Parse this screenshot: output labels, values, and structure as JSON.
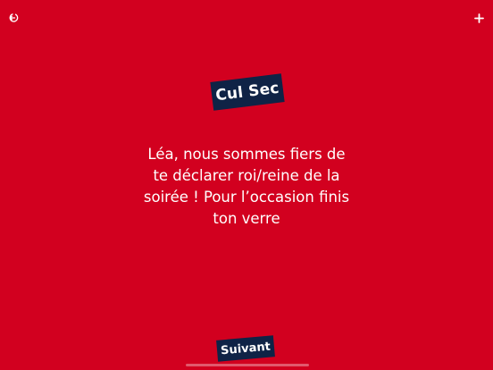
{
  "header": {
    "exit_icon": "exit-icon",
    "add_icon": "plus-icon"
  },
  "card": {
    "category": "Cul Sec",
    "message": "Léa, nous sommes fiers de te déclarer roi/reine de la soirée ! Pour l’occasion finis ton verre"
  },
  "footer": {
    "next_label": "Suivant"
  },
  "colors": {
    "background": "#d2001f",
    "badge": "#0f2346",
    "text": "#ffffff"
  }
}
